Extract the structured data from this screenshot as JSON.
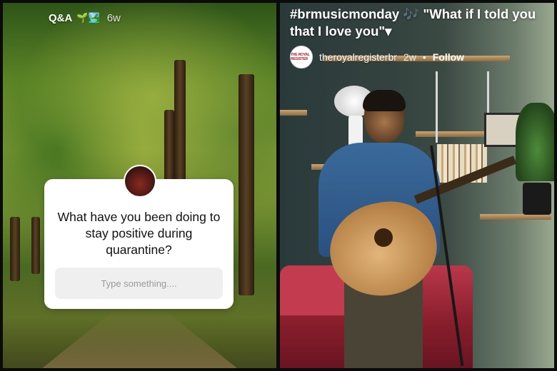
{
  "left_story": {
    "header": {
      "title": "Q&A",
      "emoji": "🌱🏞️",
      "time": "6w"
    },
    "question_card": {
      "question": "What have you been doing to stay positive during quarantine?",
      "input_placeholder": "Type something...."
    }
  },
  "right_story": {
    "overlay_title": "#brmusicmonday 🎶 \"What if I told you that I love you\"",
    "dropdown_glyph": "▾",
    "account": {
      "avatar_text": "THE ROYAL REGISTER",
      "username": "theroyalregisterbr",
      "time": "2w",
      "separator": "•",
      "follow_label": "Follow"
    }
  },
  "colors": {
    "card_background": "#ffffff",
    "input_background": "#efefef",
    "sofa": "#b8384a",
    "hoodie": "#3a6a9a"
  }
}
